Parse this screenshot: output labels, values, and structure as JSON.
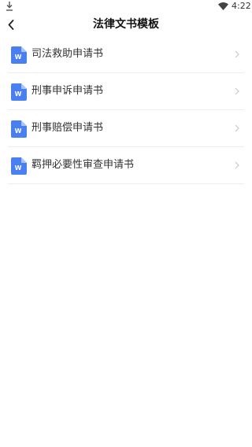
{
  "status_bar": {
    "time": "4:22",
    "icons": [
      "download-icon",
      "wifi-icon"
    ]
  },
  "header": {
    "title": "法律文书模板",
    "back_icon": "chevron-left-icon"
  },
  "colors": {
    "doc_icon_blue": "#4a7ff2",
    "doc_icon_fold": "#a9c4f8",
    "chevron_gray": "#c8c8c8",
    "divider": "#eeeeee"
  },
  "documents": [
    {
      "label": "司法救助申请书",
      "icon": "word-doc-icon",
      "icon_letter": "W"
    },
    {
      "label": "刑事申诉申请书",
      "icon": "word-doc-icon",
      "icon_letter": "W"
    },
    {
      "label": "刑事赔偿申请书",
      "icon": "word-doc-icon",
      "icon_letter": "W"
    },
    {
      "label": "羁押必要性审查申请书",
      "icon": "word-doc-icon",
      "icon_letter": "W"
    }
  ]
}
